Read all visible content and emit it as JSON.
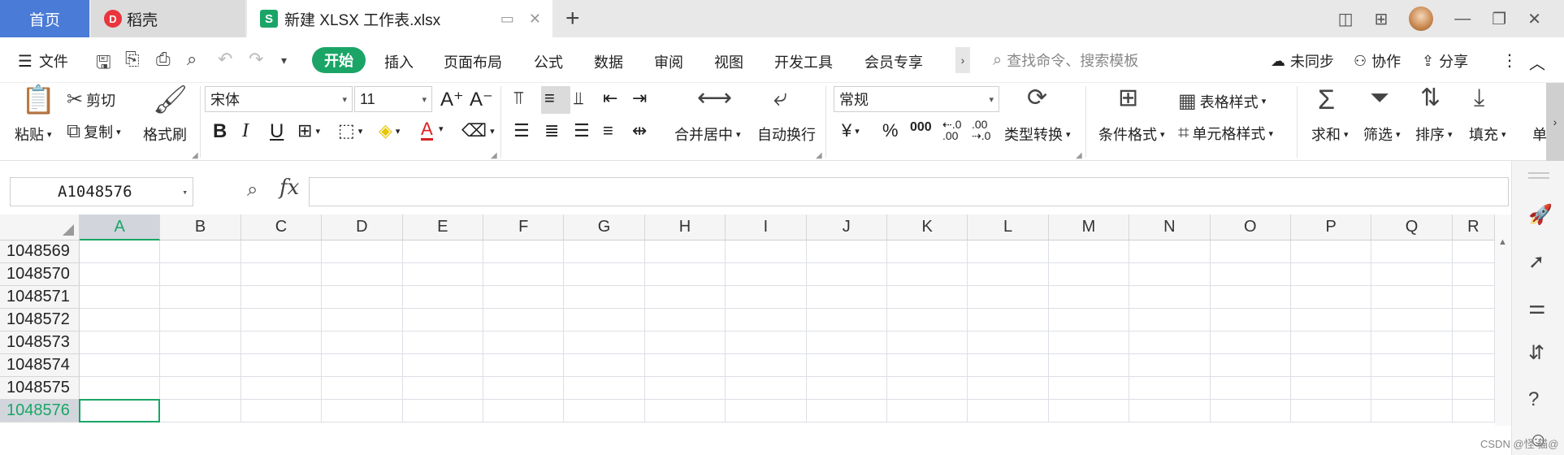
{
  "tabs": {
    "home": "首页",
    "daoke": "稻壳",
    "document": "新建 XLSX 工作表.xlsx"
  },
  "menu": {
    "file": "文件",
    "start": "开始",
    "items": [
      "插入",
      "页面布局",
      "公式",
      "数据",
      "审阅",
      "视图",
      "开发工具",
      "会员专享"
    ],
    "search_placeholder": "查找命令、搜索模板",
    "sync": "未同步",
    "collab": "协作",
    "share": "分享"
  },
  "ribbon": {
    "paste": "粘贴",
    "cut": "剪切",
    "copy": "复制",
    "format_painter": "格式刷",
    "font_name": "宋体",
    "font_size": "11",
    "merge_center": "合并居中",
    "auto_wrap": "自动换行",
    "number_format": "常规",
    "type_convert": "类型转换",
    "cond_format": "条件格式",
    "table_style": "表格样式",
    "cell_style": "单元格样式",
    "sum": "求和",
    "filter": "筛选",
    "sort": "排序",
    "fill": "填充",
    "cell_partial": "单"
  },
  "formula_bar": {
    "name_box": "A1048576",
    "fx": "fx",
    "value": ""
  },
  "sheet": {
    "columns": [
      "A",
      "B",
      "C",
      "D",
      "E",
      "F",
      "G",
      "H",
      "I",
      "J",
      "K",
      "L",
      "M",
      "N",
      "O",
      "P",
      "Q",
      "R"
    ],
    "rows": [
      "1048569",
      "1048570",
      "1048571",
      "1048572",
      "1048573",
      "1048574",
      "1048575",
      "1048576"
    ],
    "selected_column": "A",
    "selected_row": "1048576"
  },
  "watermark": "CSDN @怪 猫@",
  "colors": {
    "accent": "#1aa567",
    "home_tab": "#4a7bd6"
  }
}
